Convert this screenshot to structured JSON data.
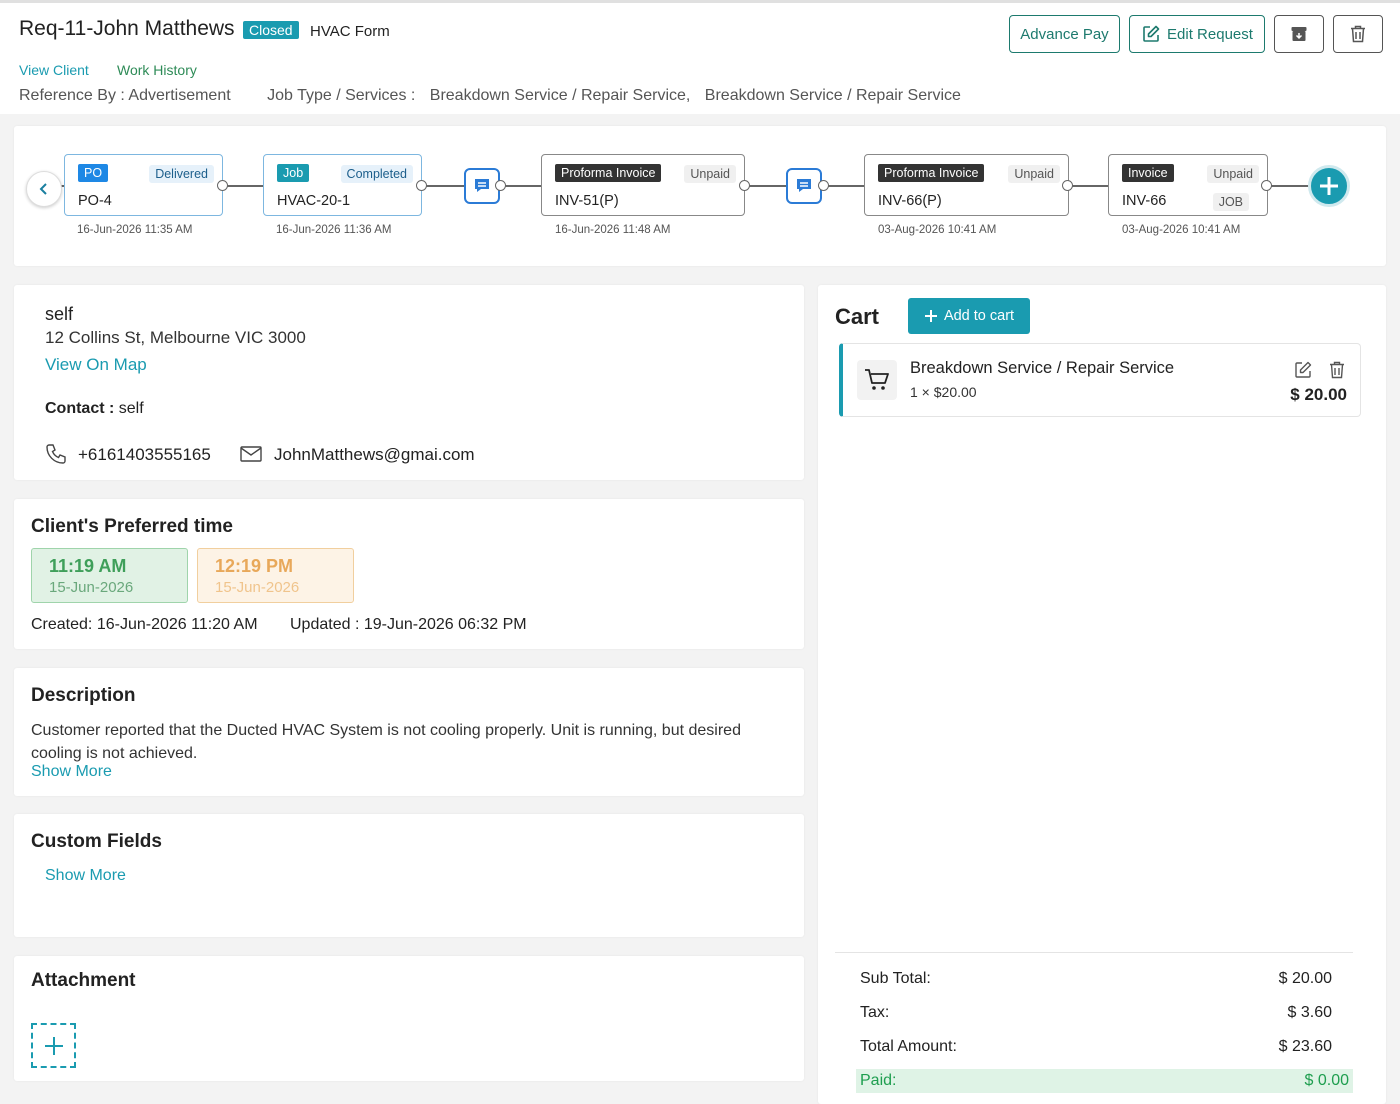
{
  "header": {
    "title": "Req-11-John Matthews",
    "status_badge": "Closed",
    "form_name": "HVAC Form",
    "view_client": "View Client",
    "work_history": "Work History",
    "reference_by": "Reference By : Advertisement",
    "job_type_label": "Job Type / Services :",
    "job_type_1": "Breakdown Service / Repair Service,",
    "job_type_2": "Breakdown Service / Repair Service",
    "advance_pay": "Advance Pay",
    "edit_request": "Edit Request",
    "archive_icon": "archive-icon",
    "delete_icon": "trash-icon"
  },
  "timeline": {
    "items": [
      {
        "tag": "PO",
        "status": "Delivered",
        "code": "PO-4",
        "date": "16-Jun-2026 11:35 AM"
      },
      {
        "tag": "Job",
        "status": "Completed",
        "code": "HVAC-20-1",
        "date": "16-Jun-2026 11:36 AM"
      },
      {
        "tag": "Proforma Invoice",
        "status": "Unpaid",
        "code": "INV-51(P)",
        "date": "16-Jun-2026 11:48 AM"
      },
      {
        "tag": "Proforma Invoice",
        "status": "Unpaid",
        "code": "INV-66(P)",
        "date": "03-Aug-2026 10:41 AM"
      },
      {
        "tag": "Invoice",
        "status": "Unpaid",
        "status2": "JOB",
        "code": "INV-66",
        "date": "03-Aug-2026 10:41 AM"
      }
    ],
    "colors": {
      "po": "#1e88e5",
      "job": "#1a9bb0",
      "invoice": "#333333",
      "add": "#1a9bb0"
    }
  },
  "client": {
    "name": "self",
    "address": "12 Collins St, Melbourne VIC 3000",
    "view_on_map": "View On Map",
    "contact_label": "Contact :",
    "contact_value": "self",
    "phone": "+6161403555165",
    "email": "JohnMatthews@gmai.com"
  },
  "preferred_time": {
    "title": "Client's Preferred time",
    "start_time": "11:19 AM",
    "start_date": "15-Jun-2026",
    "end_time": "12:19 PM",
    "end_date": "15-Jun-2026",
    "created": "Created: 16-Jun-2026 11:20 AM",
    "updated": "Updated : 19-Jun-2026 06:32 PM"
  },
  "description": {
    "title": "Description",
    "text": "Customer reported that the Ducted HVAC System is not cooling properly. Unit is running, but desired cooling is not achieved.",
    "show_more": "Show More"
  },
  "custom_fields": {
    "title": "Custom Fields",
    "show_more": "Show More"
  },
  "attachment": {
    "title": "Attachment"
  },
  "cart": {
    "title": "Cart",
    "add_to_cart": "Add to cart",
    "item_name": "Breakdown Service / Repair Service",
    "item_qty": "1 × $20.00",
    "item_total": "$ 20.00",
    "subtotal_label": "Sub Total:",
    "subtotal_value": "$ 20.00",
    "tax_label": "Tax:",
    "tax_value": "$ 3.60",
    "total_label": "Total Amount:",
    "total_value": "$ 23.60",
    "paid_label": "Paid:",
    "paid_value": "$ 0.00"
  }
}
